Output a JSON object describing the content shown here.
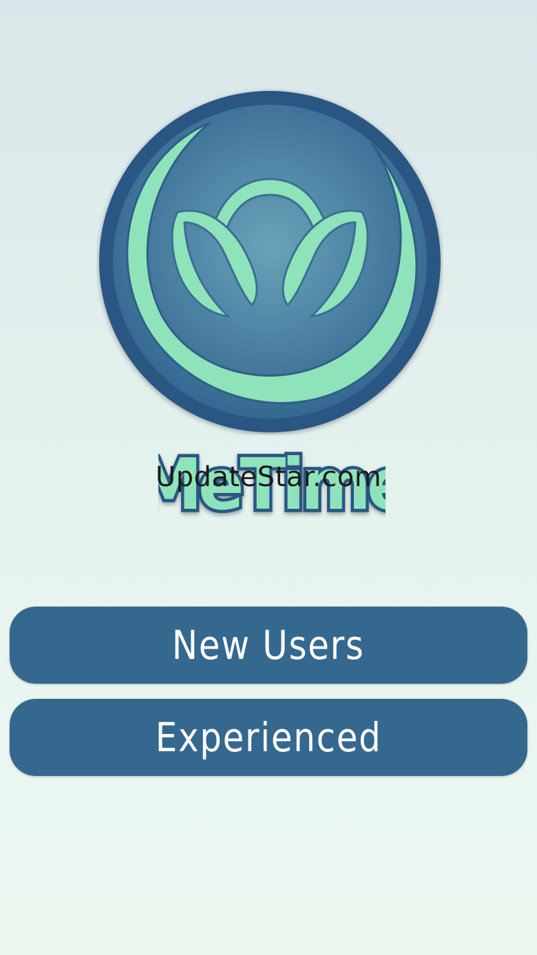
{
  "app": {
    "brand_name": "MeTime",
    "logo_icon": "lotus-icon"
  },
  "watermark": {
    "text": "UpdateStar.com"
  },
  "buttons": {
    "new_users_label": "New Users",
    "experienced_label": "Experienced"
  },
  "colors": {
    "button_bg": "#35688f",
    "button_text": "#ffffff",
    "logo_mint": "#8fe3bb",
    "logo_ring": "#2b5b86",
    "logo_disc": "#4f86a6"
  }
}
